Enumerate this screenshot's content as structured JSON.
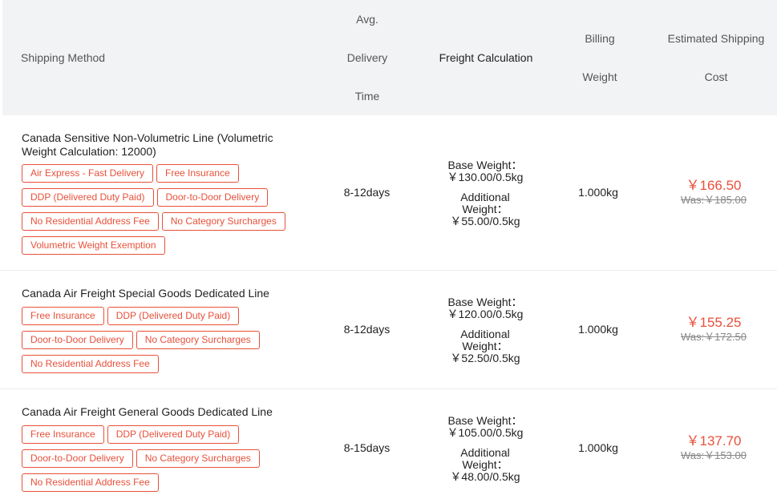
{
  "headers": {
    "method": "Shipping Method",
    "time_lines": [
      "Avg.",
      "Delivery",
      "Time"
    ],
    "freight": "Freight Calculation",
    "billing_lines": [
      "Billing",
      "Weight"
    ],
    "cost_lines": [
      "Estimated Shipping",
      "Cost"
    ]
  },
  "rows": [
    {
      "name": "Canada Sensitive Non-Volumetric Line (Volumetric Weight Calculation: 12000)",
      "tags": [
        "Air Express - Fast Delivery",
        "Free Insurance",
        "DDP (Delivered Duty Paid)",
        "Door-to-Door Delivery",
        "No Residential Address Fee",
        "No Category Surcharges",
        "Volumetric Weight Exemption"
      ],
      "delivery": "8-12days",
      "base_label": "Base Weight：",
      "base_value": "￥130.00/0.5kg",
      "add_label": "Additional Weight：",
      "add_value": "￥55.00/0.5kg",
      "billing": "1.000kg",
      "price": "￥166.50",
      "was": "Was:￥185.00"
    },
    {
      "name": "Canada Air Freight Special Goods Dedicated Line",
      "tags": [
        "Free Insurance",
        "DDP (Delivered Duty Paid)",
        "Door-to-Door Delivery",
        "No Category Surcharges",
        "No Residential Address Fee"
      ],
      "delivery": "8-12days",
      "base_label": "Base Weight：",
      "base_value": "￥120.00/0.5kg",
      "add_label": "Additional Weight：",
      "add_value": "￥52.50/0.5kg",
      "billing": "1.000kg",
      "price": "￥155.25",
      "was": "Was:￥172.50"
    },
    {
      "name": "Canada Air Freight General Goods Dedicated Line",
      "tags": [
        "Free Insurance",
        "DDP (Delivered Duty Paid)",
        "Door-to-Door Delivery",
        "No Category Surcharges",
        "No Residential Address Fee"
      ],
      "delivery": "8-15days",
      "base_label": "Base Weight：",
      "base_value": "￥105.00/0.5kg",
      "add_label": "Additional Weight：",
      "add_value": "￥48.00/0.5kg",
      "billing": "1.000kg",
      "price": "￥137.70",
      "was": "Was:￥153.00"
    }
  ],
  "colors": {
    "accent": "#e8503a",
    "header_bg": "#f2f3f5"
  }
}
